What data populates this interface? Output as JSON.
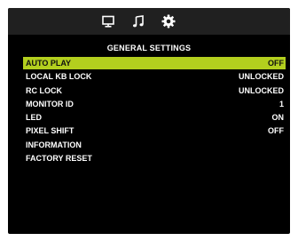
{
  "tabs": [
    {
      "name": "picture",
      "icon": "monitor-icon",
      "active": false
    },
    {
      "name": "audio",
      "icon": "music-note-icon",
      "active": false
    },
    {
      "name": "settings",
      "icon": "gear-icon",
      "active": true
    }
  ],
  "section_title": "GENERAL  SETTINGS",
  "colors": {
    "background": "#000000",
    "topbar": "#202020",
    "highlight": "#b3cf1e",
    "text": "#ffffff",
    "selected_text": "#101010"
  },
  "menu": [
    {
      "label": "AUTO PLAY",
      "value": "OFF",
      "selected": true
    },
    {
      "label": "LOCAL KB LOCK",
      "value": "UNLOCKED",
      "selected": false
    },
    {
      "label": "RC LOCK",
      "value": "UNLOCKED",
      "selected": false
    },
    {
      "label": "MONITOR ID",
      "value": "1",
      "selected": false
    },
    {
      "label": "LED",
      "value": "ON",
      "selected": false
    },
    {
      "label": "PIXEL SHIFT",
      "value": "OFF",
      "selected": false
    },
    {
      "label": "INFORMATION",
      "value": "",
      "selected": false
    },
    {
      "label": "FACTORY RESET",
      "value": "",
      "selected": false
    }
  ]
}
